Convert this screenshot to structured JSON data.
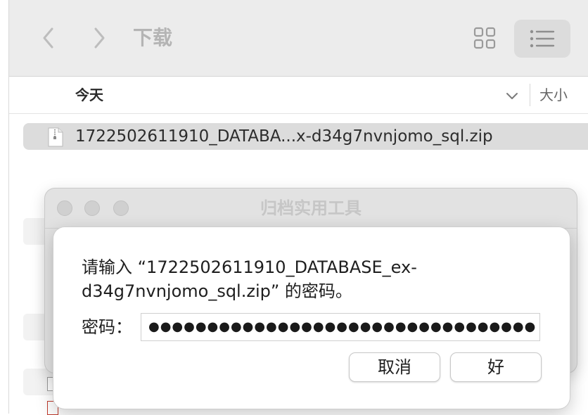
{
  "finder": {
    "title": "下载",
    "back_icon": "chevron-left-icon",
    "forward_icon": "chevron-right-icon",
    "grid_view_icon": "grid-view-icon",
    "list_view_icon": "list-view-icon",
    "group_label": "今天",
    "size_column": "大小",
    "files": [
      {
        "name": "1722502611910_DATABA...x-d34g7nvnjomo_sql.zip",
        "icon": "zip-file-icon"
      }
    ]
  },
  "archive_utility": {
    "title": "归档实用工具"
  },
  "password_dialog": {
    "prompt": "请输入 “1722502611910_DATABASE_ex-d34g7nvnjomo_sql.zip” 的密码。",
    "password_label": "密码：",
    "password_value": "●●●●●●●●●●●●●●●●●●●●●●●●●●●●●●●●●",
    "cancel_label": "取消",
    "ok_label": "好"
  },
  "colors": {
    "toolbar_bg": "#ececec",
    "selection_bg": "#dcdcdc",
    "dialog_bg": "#ffffff"
  }
}
